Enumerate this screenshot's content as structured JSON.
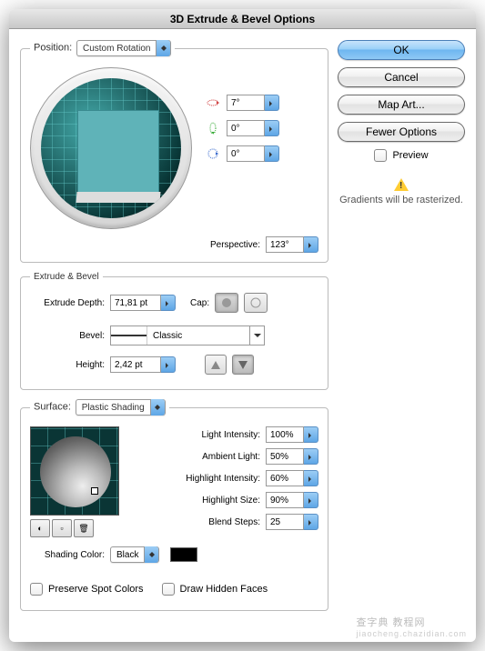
{
  "title": "3D Extrude & Bevel Options",
  "position": {
    "legend": "Position:",
    "rotation": "Custom Rotation",
    "rx": "7°",
    "ry": "0°",
    "rz": "0°",
    "perspective_label": "Perspective:",
    "perspective": "123°"
  },
  "extrude": {
    "legend": "Extrude & Bevel",
    "depth_label": "Extrude Depth:",
    "depth": "71,81 pt",
    "cap_label": "Cap:",
    "bevel_label": "Bevel:",
    "bevel": "Classic",
    "height_label": "Height:",
    "height": "2,42 pt"
  },
  "surface": {
    "legend": "Surface:",
    "shading": "Plastic Shading",
    "light_intensity_label": "Light Intensity:",
    "light_intensity": "100%",
    "ambient_label": "Ambient Light:",
    "ambient": "50%",
    "highlight_intensity_label": "Highlight Intensity:",
    "highlight_intensity": "60%",
    "highlight_size_label": "Highlight Size:",
    "highlight_size": "90%",
    "blend_label": "Blend Steps:",
    "blend": "25",
    "shading_color_label": "Shading Color:",
    "shading_color": "Black",
    "preserve_spot": "Preserve Spot Colors",
    "draw_hidden": "Draw Hidden Faces"
  },
  "buttons": {
    "ok": "OK",
    "cancel": "Cancel",
    "map_art": "Map Art...",
    "fewer": "Fewer Options",
    "preview": "Preview",
    "warning": "Gradients will be rasterized."
  },
  "watermark": {
    "main": "查字典 教程网",
    "sub": "jiaocheng.chazidian.com"
  }
}
